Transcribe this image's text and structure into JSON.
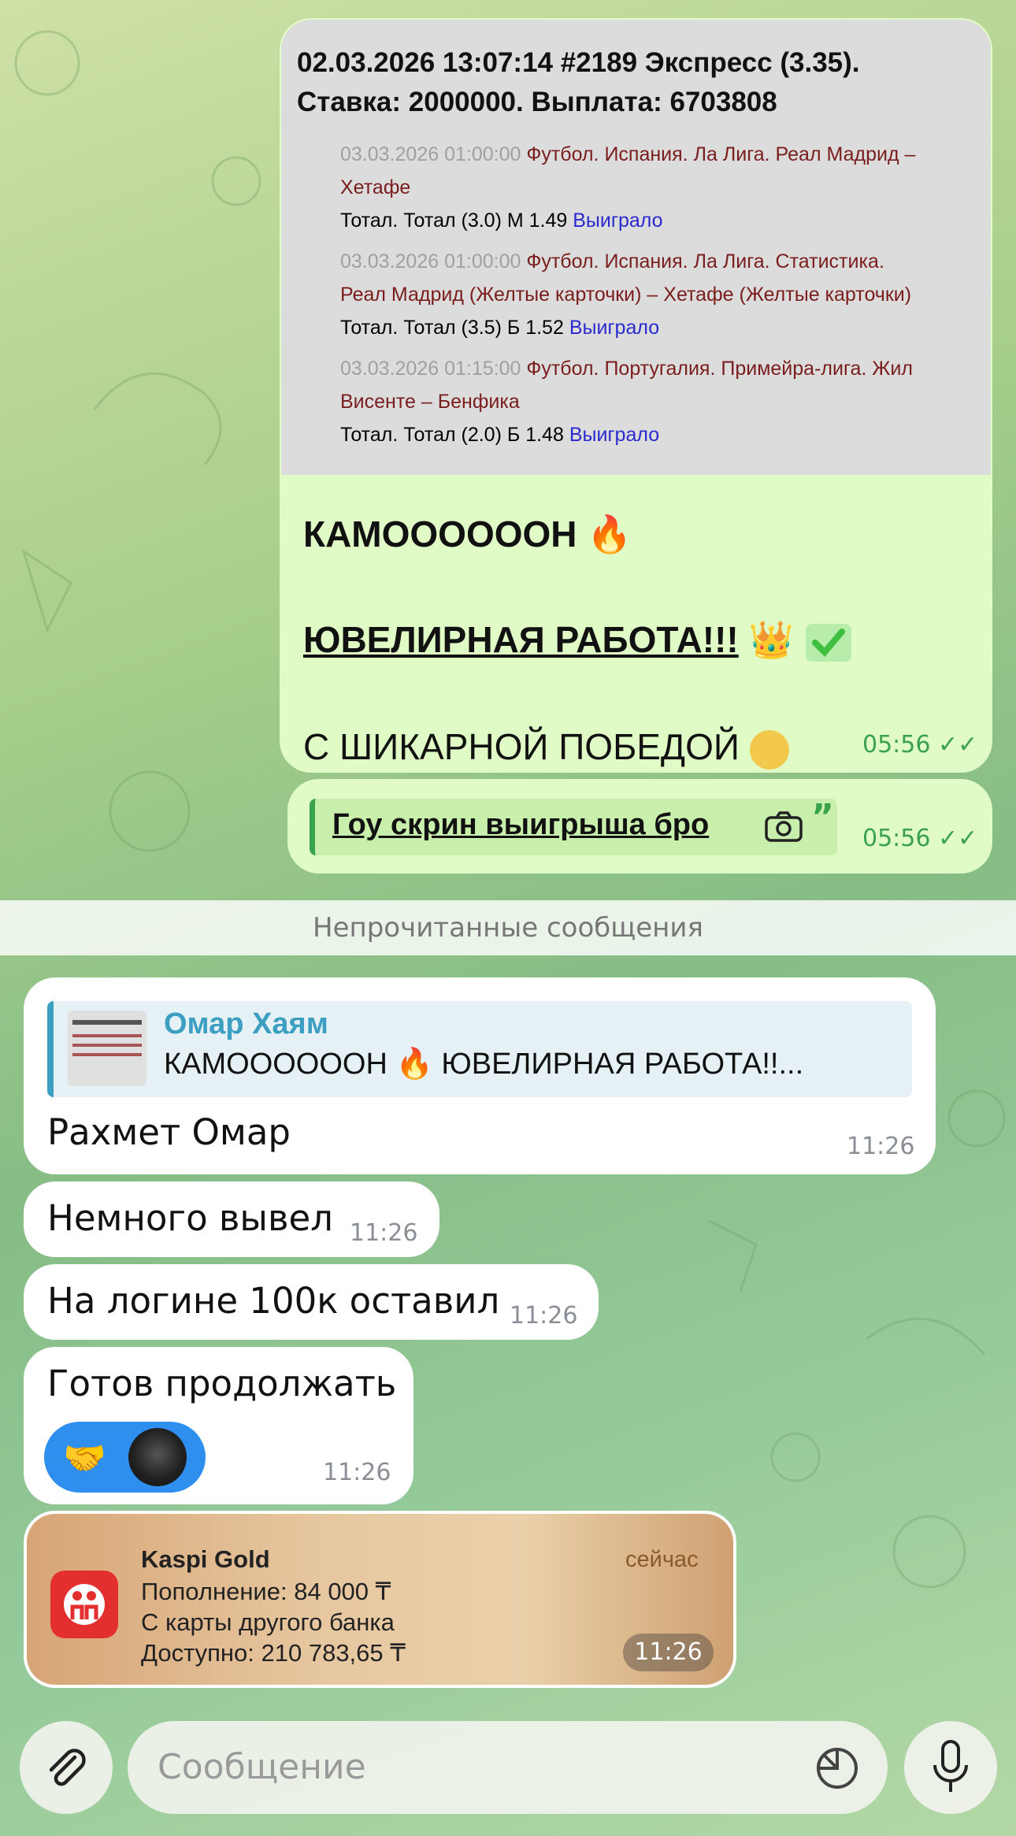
{
  "bet": {
    "header_line1": "02.03.2026 13:07:14 #2189 Экспресс (3.35).",
    "header_line2": "Ставка: 2000000. Выплата: 6703808",
    "events": [
      {
        "date": "03.03.2026 01:00:00",
        "title_a": "Футбол. Испания. Ла Лига. Реал Мадрид –",
        "title_b": "Хетафе",
        "market": "Тотал. Тотал (3.0) М 1.49",
        "status": "Выиграло"
      },
      {
        "date": "03.03.2026 01:00:00",
        "title_a": "Футбол. Испания. Ла Лига. Статистика.",
        "title_b": "Реал Мадрид (Желтые карточки) – Хетафе (Желтые карточки)",
        "market": "Тотал. Тотал (3.5) Б 1.52",
        "status": "Выиграло"
      },
      {
        "date": "03.03.2026 01:15:00",
        "title_a": "Футбол. Португалия. Примейра-лига. Жил",
        "title_b": "Висенте – Бенфика",
        "market": "Тотал. Тотал (2.0) Б 1.48",
        "status": "Выиграло"
      }
    ]
  },
  "outgoing": {
    "line1": "КАМООООООН 🔥",
    "line2": "ЮВЕЛИРНАЯ РАБОТА!!!",
    "line2_emoji": "👑",
    "line3": "С ШИКАРНОЙ ПОБЕДОЙ",
    "time": "05:56",
    "quote_text": "Гоу скрин выигрыша бро",
    "quote_time": "05:56"
  },
  "unread_label": "Непрочитанные сообщения",
  "incoming": {
    "reply_author": "Омар Хаям",
    "reply_text": "КАМООООООН 🔥 ЮВЕЛИРНАЯ РАБОТА!!...",
    "m1": "Рахмет Омар",
    "m1_time": "11:26",
    "m2": "Немного вывел",
    "m2_time": "11:26",
    "m3": "На логине 100к оставил",
    "m3_time": "11:26",
    "m4": "Готов продолжать",
    "m4_time": "11:26",
    "m4_reaction": "🤝",
    "notif_app": "Kaspi Gold",
    "notif_when": "сейчас",
    "notif_l1": "Пополнение: 84 000 ₸",
    "notif_l2": "С карты другого банка",
    "notif_l3": "Доступно: 210 783,65 ₸",
    "notif_time": "11:26"
  },
  "composer": {
    "placeholder": "Сообщение"
  }
}
